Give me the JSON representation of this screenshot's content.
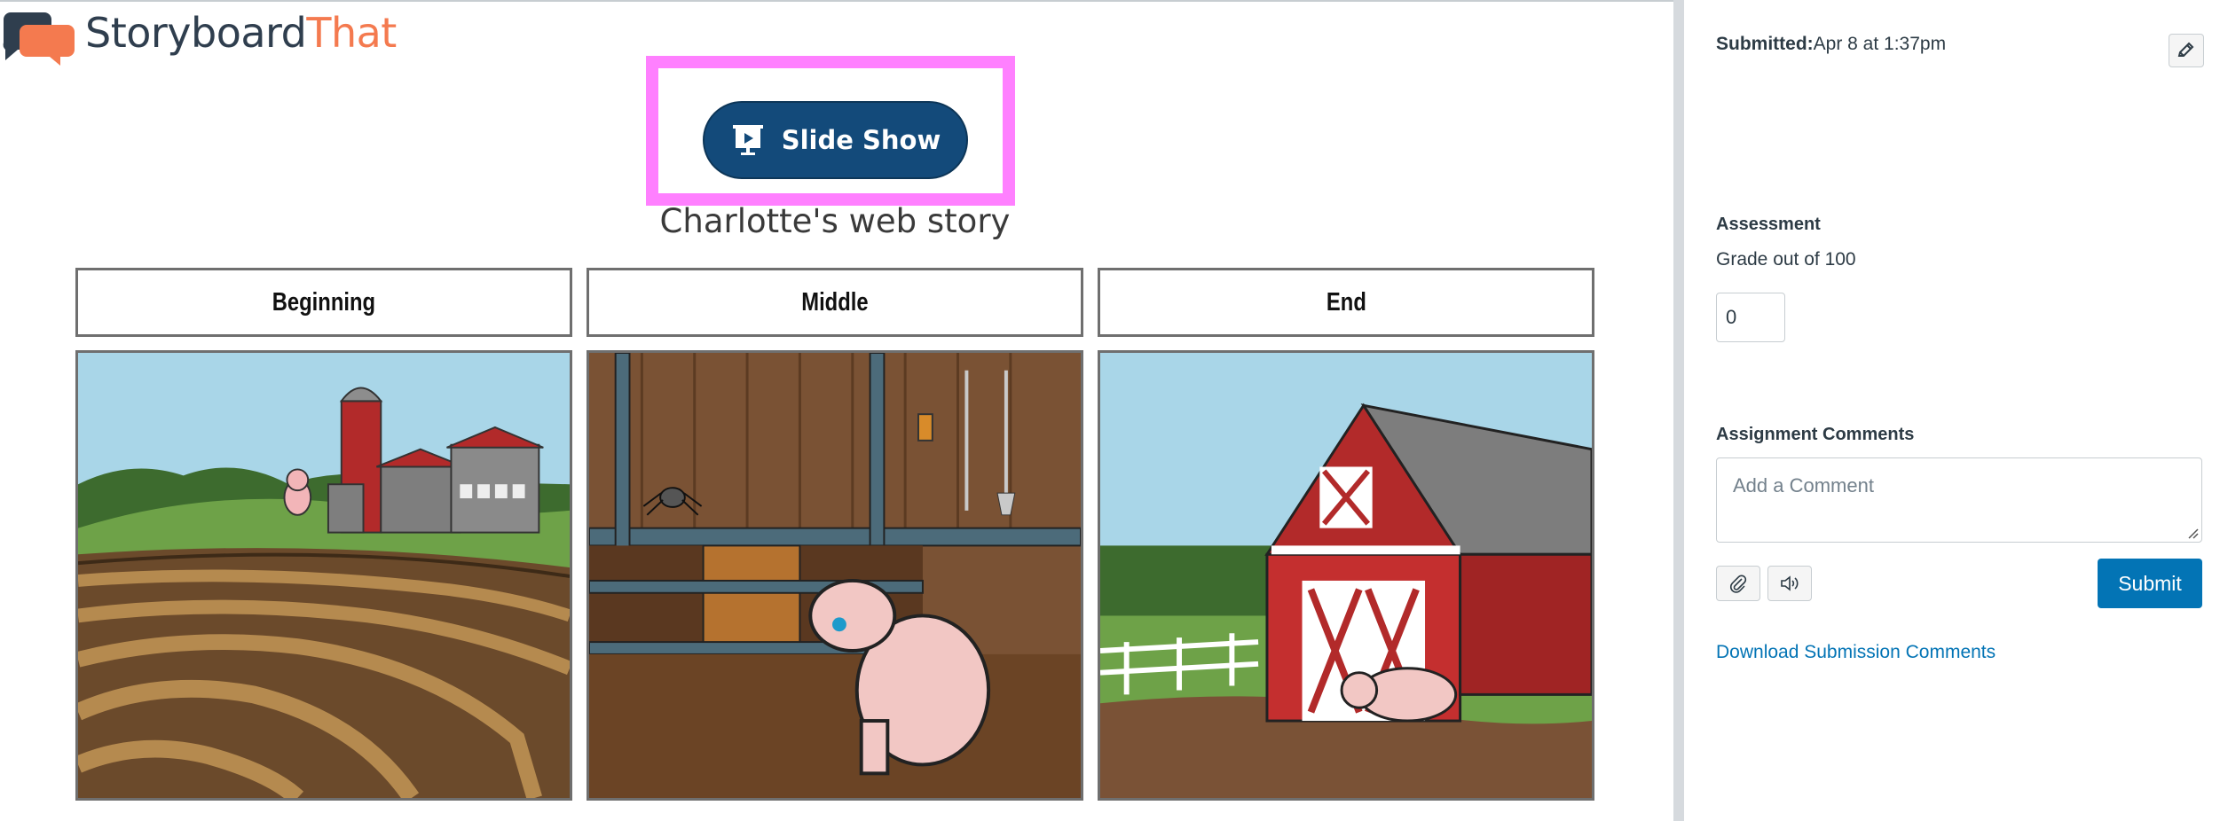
{
  "brand": {
    "name_part1": "Storyboard",
    "name_part2": "That",
    "color_dark": "#2f3e4e",
    "color_accent": "#f47a4f"
  },
  "storyboard": {
    "slideshow_label": "Slide Show",
    "highlight_color": "#ff80ff",
    "title": "Charlotte's web story",
    "columns": [
      {
        "header": "Beginning",
        "scene": "farm-with-pig-and-fields"
      },
      {
        "header": "Middle",
        "scene": "barn-interior-crying-pig-and-spider"
      },
      {
        "header": "End",
        "scene": "red-barn-with-pig"
      }
    ]
  },
  "sidebar": {
    "submitted_label": "Submitted:",
    "submitted_value": "Apr 8 at 1:37pm",
    "assessment_title": "Assessment",
    "grade_label": "Grade out of 100",
    "grade_value": "0",
    "comments_title": "Assignment Comments",
    "comment_placeholder": "Add a Comment",
    "submit_label": "Submit",
    "download_link": "Download Submission Comments",
    "accent_color": "#0374b5"
  }
}
